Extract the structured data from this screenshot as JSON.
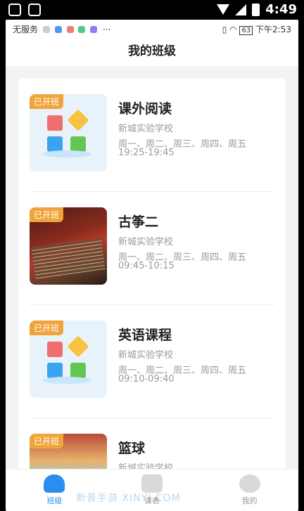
{
  "android_status": {
    "time": "4:49"
  },
  "status_bar": {
    "carrier": "无服务",
    "battery": "63",
    "time": "下午2:53"
  },
  "page_title": "我的班级",
  "badge_label": "已开班",
  "courses": [
    {
      "name": "课外阅读",
      "school": "新城实验学校",
      "days": "周一、周二、周三、周四、周五",
      "time": "19:25-19:45",
      "thumb": "book-illustration"
    },
    {
      "name": "古筝二",
      "school": "新城实验学校",
      "days": "周一、周二、周三、周四、周五",
      "time": "09:45-10:15",
      "thumb": "guzheng-photo"
    },
    {
      "name": "英语课程",
      "school": "新城实验学校",
      "days": "周一、周二、周三、周四、周五",
      "time": "09:10-09:40",
      "thumb": "book-illustration"
    },
    {
      "name": "篮球",
      "school": "新城实验学校",
      "days": "",
      "time": "",
      "thumb": "basketball-photo"
    }
  ],
  "tabs": [
    {
      "label": "班级",
      "icon": "home-icon",
      "active": true
    },
    {
      "label": "课表",
      "icon": "schedule-icon",
      "active": false
    },
    {
      "label": "我的",
      "icon": "profile-icon",
      "active": false
    }
  ],
  "watermark": "新普手游 XINYI.COM"
}
